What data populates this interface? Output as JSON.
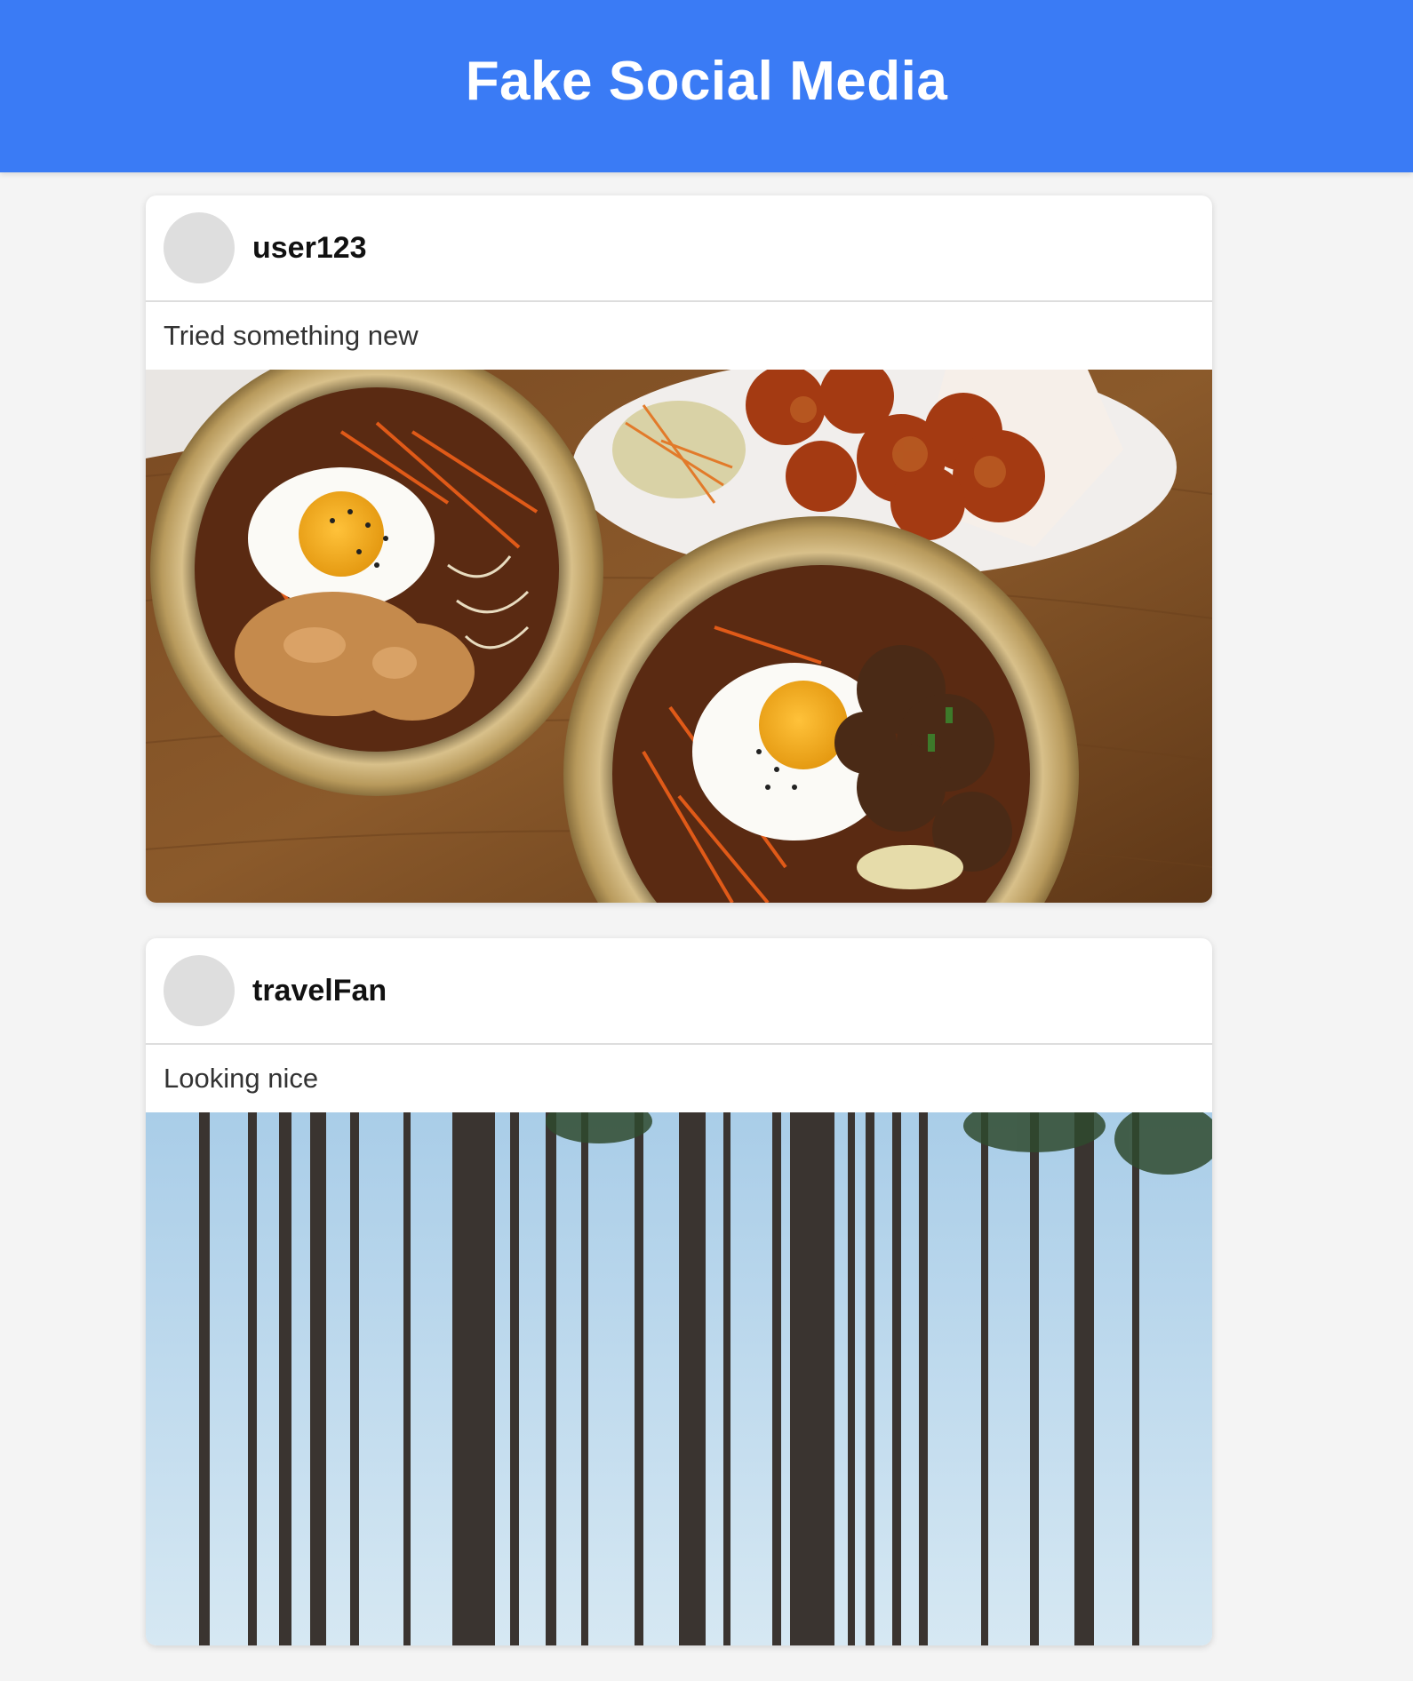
{
  "header": {
    "title": "Fake Social Media"
  },
  "feed": {
    "posts": [
      {
        "username": "user123",
        "caption": "Tried something new",
        "image": "food-photo"
      },
      {
        "username": "travelFan",
        "caption": "Looking nice",
        "image": "forest-photo"
      }
    ]
  },
  "colors": {
    "header_bg": "#3a7bf5",
    "page_bg": "#f4f4f4",
    "card_bg": "#ffffff",
    "avatar": "#dedede"
  }
}
